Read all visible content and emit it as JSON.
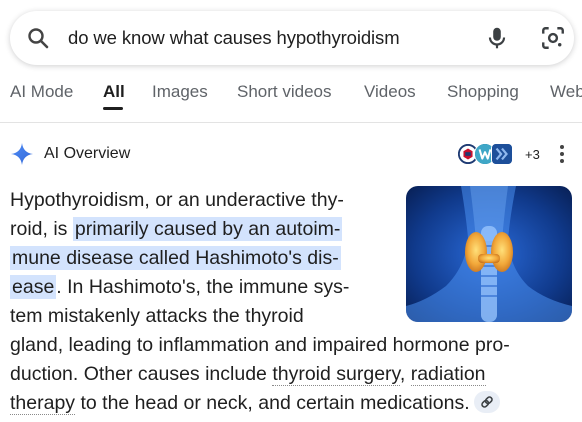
{
  "search": {
    "query": "do we know what causes hypothyroidism"
  },
  "tabs": [
    {
      "label": "AI Mode"
    },
    {
      "label": "All"
    },
    {
      "label": "Images"
    },
    {
      "label": "Short videos"
    },
    {
      "label": "Videos"
    },
    {
      "label": "Shopping"
    },
    {
      "label": "Web"
    }
  ],
  "ai_overview": {
    "title": "AI Overview",
    "sources_more": "+3",
    "lines": [
      {
        "parts": [
          {
            "t": "Hypothyroidism, or an underactive thy-"
          }
        ]
      },
      {
        "parts": [
          {
            "t": "roid, is "
          },
          {
            "t": "primarily caused by an autoim-",
            "hl": true
          }
        ]
      },
      {
        "parts": [
          {
            "t": "mune disease called Hashimoto's dis-",
            "hl": true
          }
        ]
      },
      {
        "parts": [
          {
            "t": "ease",
            "hl": true
          },
          {
            "t": ". In Hashimoto's, the immune sys-"
          }
        ]
      },
      {
        "parts": [
          {
            "t": "tem mistakenly attacks the thyroid"
          }
        ]
      },
      {
        "parts": [
          {
            "t": "gland, leading to inflammation and impaired hormone pro-"
          }
        ]
      },
      {
        "parts": [
          {
            "t": "duction. Other causes include "
          },
          {
            "t": "thyroid surgery",
            "ul": true
          },
          {
            "t": ", "
          },
          {
            "t": "radiation",
            "ul": true
          }
        ]
      },
      {
        "parts": [
          {
            "t": "therapy",
            "ul": true
          },
          {
            "t": " to the head or neck, and certain medications."
          }
        ],
        "chip": true
      }
    ]
  },
  "colors": {
    "highlight": "#d3e3fd",
    "gemini_blue": "#4285f4"
  },
  "icons": {
    "search": "magnifier-icon",
    "voice": "microphone-icon",
    "lens": "camera-lens-icon",
    "sparkle": "ai-sparkle-icon",
    "more": "kebab-menu-icon",
    "link": "link-icon"
  }
}
